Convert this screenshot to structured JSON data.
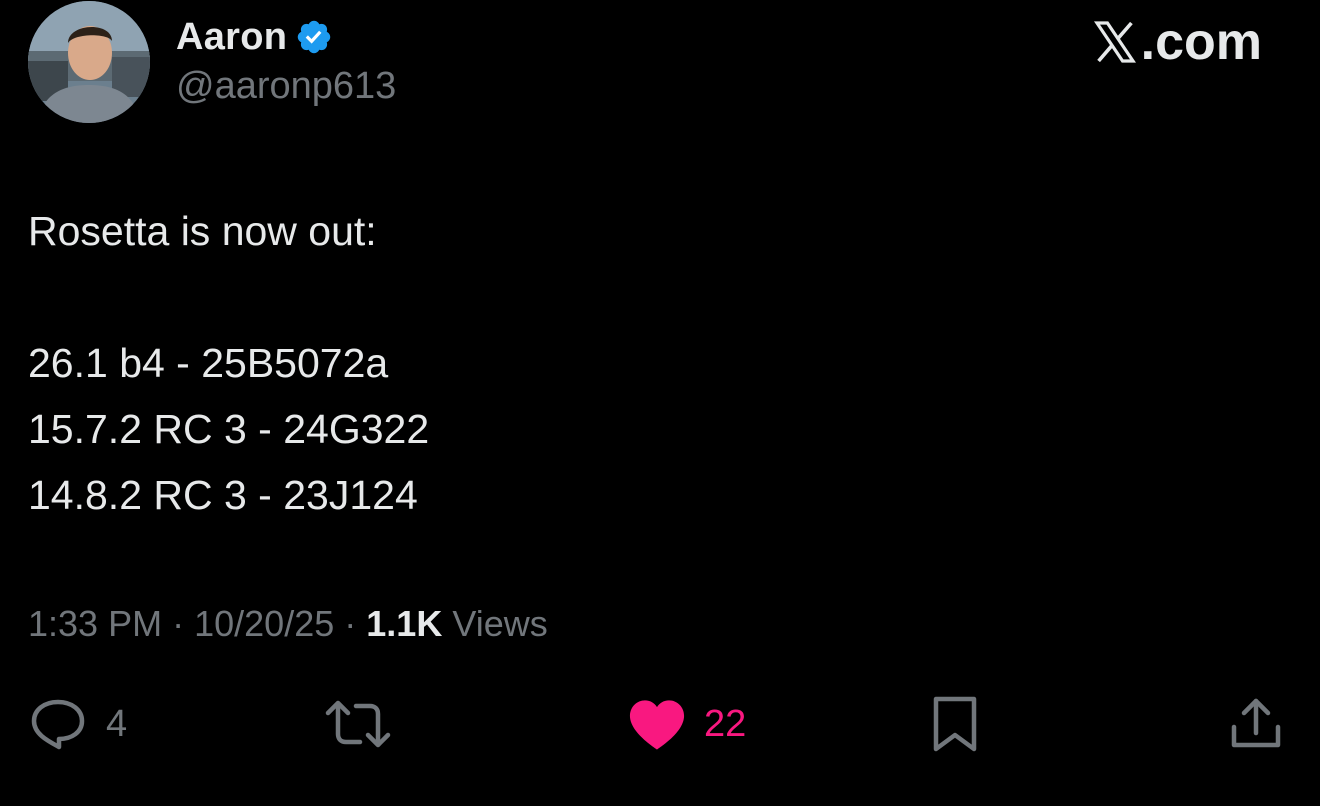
{
  "author": {
    "display_name": "Aaron",
    "handle": "@aaronp613",
    "verified": true,
    "avatar_icon": "profile-photo"
  },
  "brand": {
    "label": ".com",
    "icon": "x-logo-icon"
  },
  "tweet": {
    "lines": [
      "Rosetta is now out:",
      "",
      "26.1 b4 - 25B5072a",
      "15.7.2 RC 3 - 24G322",
      "14.8.2 RC 3 - 23J124"
    ]
  },
  "meta": {
    "time": "1:33 PM",
    "separator": "·",
    "date": "10/20/25",
    "views_count": "1.1K",
    "views_label": "Views"
  },
  "actions": {
    "reply": {
      "icon": "reply-icon",
      "count": "4"
    },
    "retweet": {
      "icon": "retweet-icon",
      "count": ""
    },
    "like": {
      "icon": "heart-icon",
      "count": "22",
      "active": true
    },
    "bookmark": {
      "icon": "bookmark-icon"
    },
    "share": {
      "icon": "share-icon"
    }
  },
  "colors": {
    "background": "#000000",
    "text": "#e7e9ea",
    "secondary_text": "#71767b",
    "verified_badge": "#1d9bf0",
    "like_active": "#f91880"
  }
}
